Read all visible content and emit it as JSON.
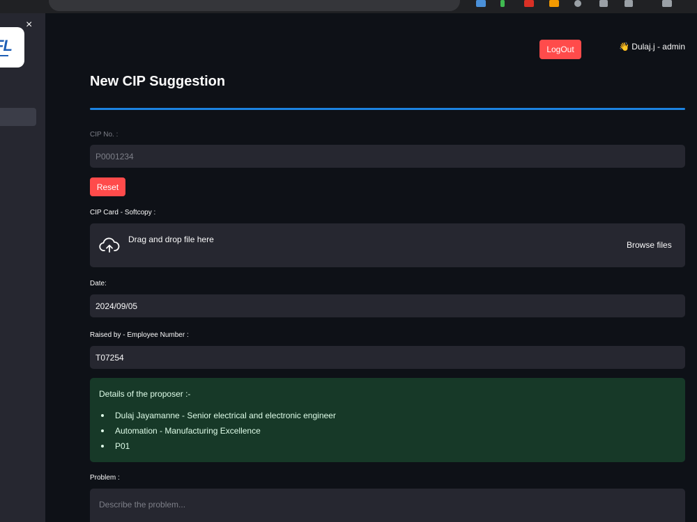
{
  "browser": {
    "url_fragment": "p"
  },
  "sidebar": {
    "logo_text": "FL",
    "close_glyph": "×"
  },
  "header": {
    "logout_label": "LogOut",
    "user_emoji": "👋",
    "user_greeting": "Dulaj.j - admin"
  },
  "page": {
    "title": "New CIP Suggestion"
  },
  "form": {
    "cip_no_label": "CIP No. :",
    "cip_no_placeholder": "P0001234",
    "reset_label": "Reset",
    "cip_card_label": "CIP Card - Softcopy :",
    "upload_text": "Drag and drop file here",
    "browse_label": "Browse files",
    "date_label": "Date:",
    "date_value": "2024/09/05",
    "raised_by_label": "Raised by - Employee Number :",
    "employee_number_value": "T07254",
    "problem_label": "Problem :",
    "problem_placeholder": "Describe the problem..."
  },
  "proposer": {
    "heading": "Details of the proposer :-",
    "items": [
      "Dulaj Jayamanne - Senior electrical and electronic engineer",
      "Automation - Manufacturing Excellence",
      "P01"
    ]
  },
  "colors": {
    "background": "#0e1117",
    "sidebar": "#262730",
    "accent_red": "#ff4b4b",
    "divider_blue": "#1c83e1",
    "success_bg": "#173928"
  }
}
